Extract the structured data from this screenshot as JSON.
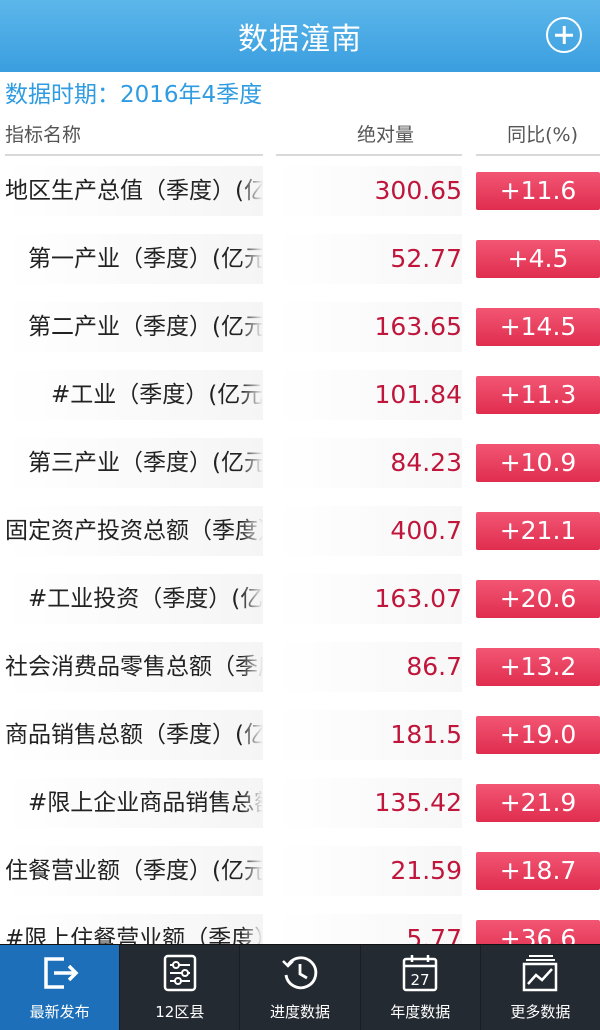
{
  "header": {
    "title": "数据潼南",
    "add_icon": "plus-circle-icon"
  },
  "period": {
    "text": "数据时期：2016年4季度"
  },
  "columns": {
    "name": "指标名称",
    "value": "绝对量",
    "pct": "同比(%)"
  },
  "rows": [
    {
      "name": "地区生产总值（季度）(亿元)",
      "value": "300.65",
      "pct": "+11.6"
    },
    {
      "name": "　第一产业（季度）(亿元)",
      "value": "52.77",
      "pct": "+4.5"
    },
    {
      "name": "　第二产业（季度）(亿元)",
      "value": "163.65",
      "pct": "+14.5"
    },
    {
      "name": "　　#工业（季度）(亿元)",
      "value": "101.84",
      "pct": "+11.3"
    },
    {
      "name": "　第三产业（季度）(亿元)",
      "value": "84.23",
      "pct": "+10.9"
    },
    {
      "name": "固定资产投资总额（季度）",
      "value": "400.7",
      "pct": "+21.1"
    },
    {
      "name": "　#工业投资（季度）(亿元)",
      "value": "163.07",
      "pct": "+20.6"
    },
    {
      "name": "社会消费品零售总额（季度）",
      "value": "86.7",
      "pct": "+13.2"
    },
    {
      "name": "商品销售总额（季度）(亿元)",
      "value": "181.5",
      "pct": "+19.0"
    },
    {
      "name": "　#限上企业商品销售总额",
      "value": "135.42",
      "pct": "+21.9"
    },
    {
      "name": "住餐营业额（季度）(亿元)",
      "value": "21.59",
      "pct": "+18.7"
    },
    {
      "name": "#限上住餐营业额（季度）",
      "value": "5.77",
      "pct": "+36.6"
    }
  ],
  "tabs": [
    {
      "label": "最新发布",
      "icon": "export-icon",
      "active": true
    },
    {
      "label": "12区县",
      "icon": "sliders-icon",
      "active": false
    },
    {
      "label": "进度数据",
      "icon": "history-clock-icon",
      "active": false
    },
    {
      "label": "年度数据",
      "icon": "calendar-icon",
      "active": false
    },
    {
      "label": "更多数据",
      "icon": "chart-stack-icon",
      "active": false
    }
  ],
  "colors": {
    "header": "#3a9edf",
    "accent_text": "#2f9be0",
    "value_text": "#c0163c",
    "pct_bg": "#e8385a",
    "tabbar": "#242a31",
    "tab_active": "#1c6fb8"
  }
}
